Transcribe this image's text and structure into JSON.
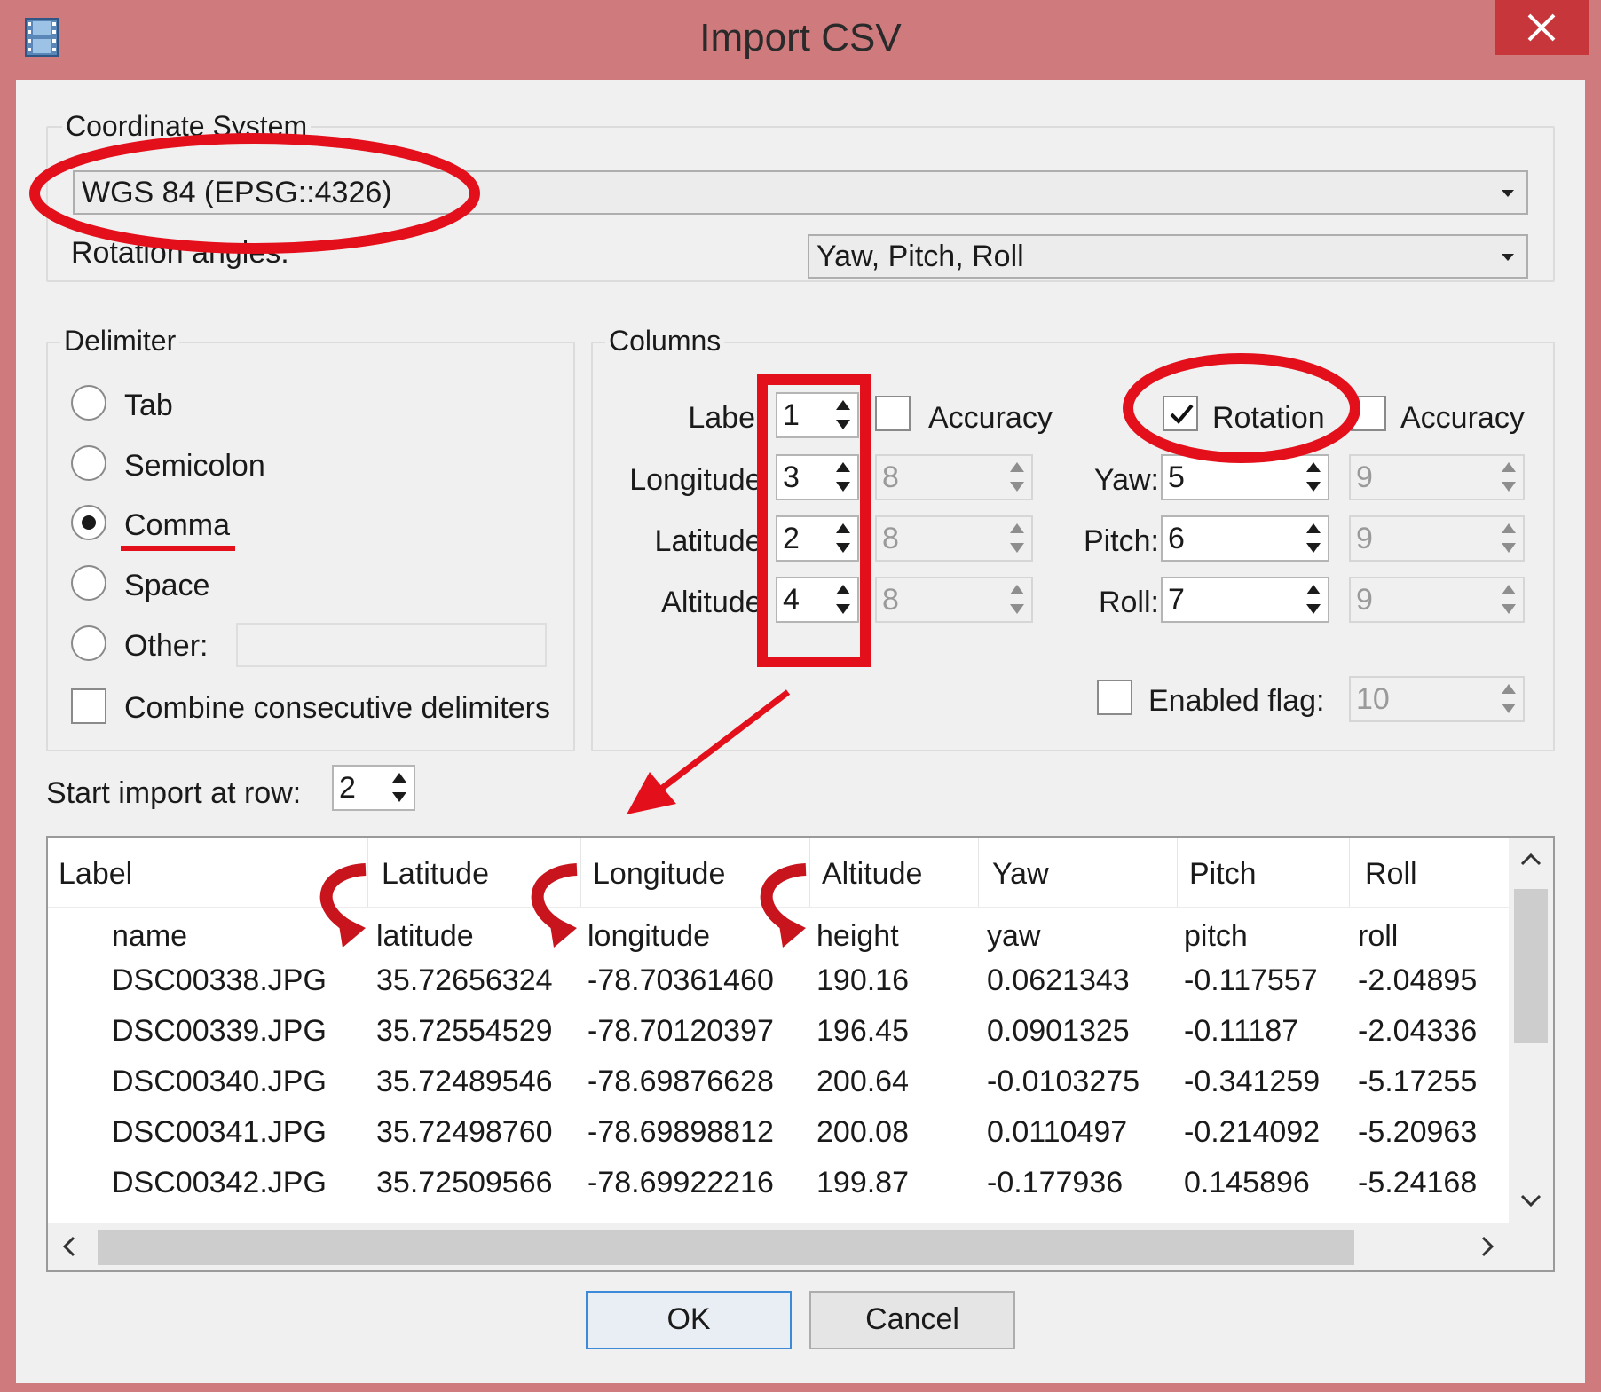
{
  "window": {
    "title": "Import CSV"
  },
  "coordinate_system": {
    "group_label": "Coordinate System",
    "value": "WGS 84 (EPSG::4326)",
    "rotation_label": "Rotation angles:",
    "rotation_value": "Yaw, Pitch, Roll"
  },
  "delimiter": {
    "group_label": "Delimiter",
    "options": [
      "Tab",
      "Semicolon",
      "Comma",
      "Space",
      "Other:"
    ],
    "selected": "Comma",
    "combine_label": "Combine consecutive delimiters"
  },
  "columns": {
    "group_label": "Columns",
    "label": {
      "label": "Label:",
      "value": "1"
    },
    "longitude": {
      "label": "Longitude:",
      "value": "3",
      "accuracy": "8"
    },
    "latitude": {
      "label": "Latitude:",
      "value": "2",
      "accuracy": "8"
    },
    "altitude": {
      "label": "Altitude:",
      "value": "4",
      "accuracy": "8"
    },
    "accuracy_label": "Accuracy",
    "rotation_label": "Rotation",
    "rotation_checked": true,
    "rotation_accuracy_label": "Accuracy",
    "yaw": {
      "label": "Yaw:",
      "value": "5",
      "accuracy": "9"
    },
    "pitch": {
      "label": "Pitch:",
      "value": "6",
      "accuracy": "9"
    },
    "roll": {
      "label": "Roll:",
      "value": "7",
      "accuracy": "9"
    },
    "enabled_flag": {
      "label": "Enabled flag:",
      "value": "10"
    }
  },
  "start_row": {
    "label": "Start import at row:",
    "value": "2"
  },
  "preview": {
    "headers": [
      "Label",
      "Latitude",
      "Longitude",
      "Altitude",
      "Yaw",
      "Pitch",
      "Roll"
    ],
    "rows": [
      [
        "name",
        "latitude",
        "longitude",
        "height",
        "yaw",
        "pitch",
        "roll"
      ],
      [
        "DSC00338.JPG",
        "35.72656324",
        "-78.70361460",
        "190.16",
        "0.0621343",
        "-0.117557",
        "-2.04895"
      ],
      [
        "DSC00339.JPG",
        "35.72554529",
        "-78.70120397",
        "196.45",
        "0.0901325",
        "-0.11187",
        "-2.04336"
      ],
      [
        "DSC00340.JPG",
        "35.72489546",
        "-78.69876628",
        "200.64",
        "-0.0103275",
        "-0.341259",
        "-5.17255"
      ],
      [
        "DSC00341.JPG",
        "35.72498760",
        "-78.69898812",
        "200.08",
        "0.0110497",
        "-0.214092",
        "-5.20963"
      ],
      [
        "DSC00342.JPG",
        "35.72509566",
        "-78.69922216",
        "199.87",
        "-0.177936",
        "0.145896",
        "-5.24168"
      ]
    ]
  },
  "buttons": {
    "ok": "OK",
    "cancel": "Cancel"
  },
  "colors": {
    "titlebar": "#cf7b7e",
    "close": "#c7363a",
    "annotation": "#e3101c",
    "dialog": "#f0f0f0"
  }
}
